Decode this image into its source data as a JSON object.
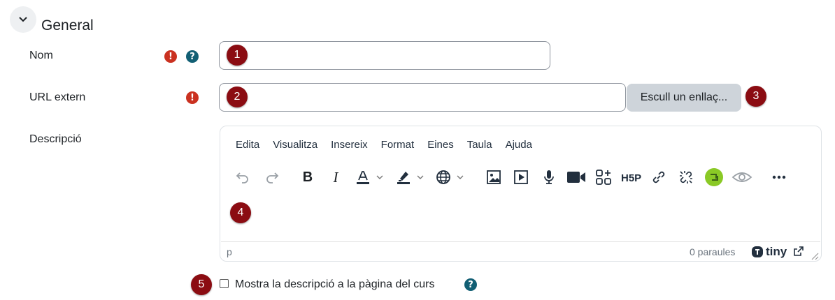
{
  "section": {
    "title": "General"
  },
  "fields": {
    "name": {
      "label": "Nom",
      "value": "",
      "marker": "1"
    },
    "url": {
      "label": "URL extern",
      "value": "",
      "marker": "2",
      "choose_link_label": "Escull un enllaç...",
      "button_marker": "3"
    },
    "description": {
      "label": "Descripció",
      "marker": "4"
    }
  },
  "editor": {
    "menu": [
      "Edita",
      "Visualitza",
      "Insereix",
      "Format",
      "Eines",
      "Taula",
      "Ajuda"
    ],
    "toolbar_icons": [
      "undo-icon",
      "redo-icon",
      "bold-icon",
      "italic-icon",
      "text-color-icon",
      "highlight-color-icon",
      "language-icon",
      "image-icon",
      "media-icon",
      "record-audio-icon",
      "record-video-icon",
      "content-bank-icon",
      "h5p-icon",
      "link-icon",
      "unlink-icon",
      "equation-icon",
      "accessibility-checker-icon",
      "more-icon"
    ],
    "bold_glyph": "B",
    "italic_glyph": "I",
    "status_element": "p",
    "word_count": "0 paraules",
    "brand": "tiny"
  },
  "show_description": {
    "label": "Mostra la descripció a la pàgina del curs",
    "marker": "5",
    "checked": false
  },
  "colors": {
    "required": "#ca3120",
    "help": "#125f74",
    "marker": "#8b0c12",
    "accent_green": "#8ac926"
  }
}
